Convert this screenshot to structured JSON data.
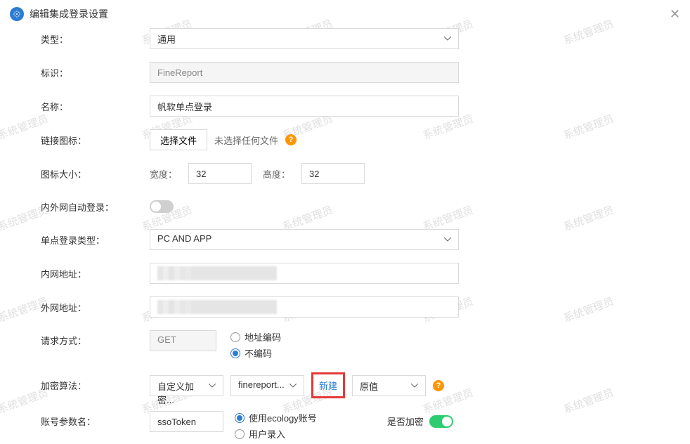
{
  "header": {
    "title": "编辑集成登录设置"
  },
  "watermark": "系统管理员",
  "fields": {
    "type": {
      "label": "类型：",
      "value": "通用"
    },
    "identifier": {
      "label": "标识：",
      "value": "FineReport"
    },
    "name": {
      "label": "名称：",
      "value": "帆软单点登录"
    },
    "linkIcon": {
      "label": "链接图标：",
      "button": "选择文件",
      "hint": "未选择任何文件"
    },
    "iconSize": {
      "label": "图标大小：",
      "widthLabel": "宽度：",
      "widthValue": "32",
      "heightLabel": "高度：",
      "heightValue": "32"
    },
    "autoLogin": {
      "label": "内外网自动登录：",
      "on": false
    },
    "ssoType": {
      "label": "单点登录类型：",
      "value": "PC AND APP"
    },
    "intranet": {
      "label": "内网地址："
    },
    "extranet": {
      "label": "外网地址："
    },
    "request": {
      "label": "请求方式：",
      "method": "GET",
      "opt1": "地址编码",
      "opt2": "不编码"
    },
    "encrypt": {
      "label": "加密算法：",
      "sel1": "自定义加密...",
      "sel2": "finereport...",
      "new": "新建",
      "sel3": "原值"
    },
    "account": {
      "label": "账号参数名：",
      "value": "ssoToken",
      "opt1": "使用ecology账号",
      "opt2": "用户录入",
      "encryptLabel": "是否加密",
      "encryptOn": true
    }
  }
}
